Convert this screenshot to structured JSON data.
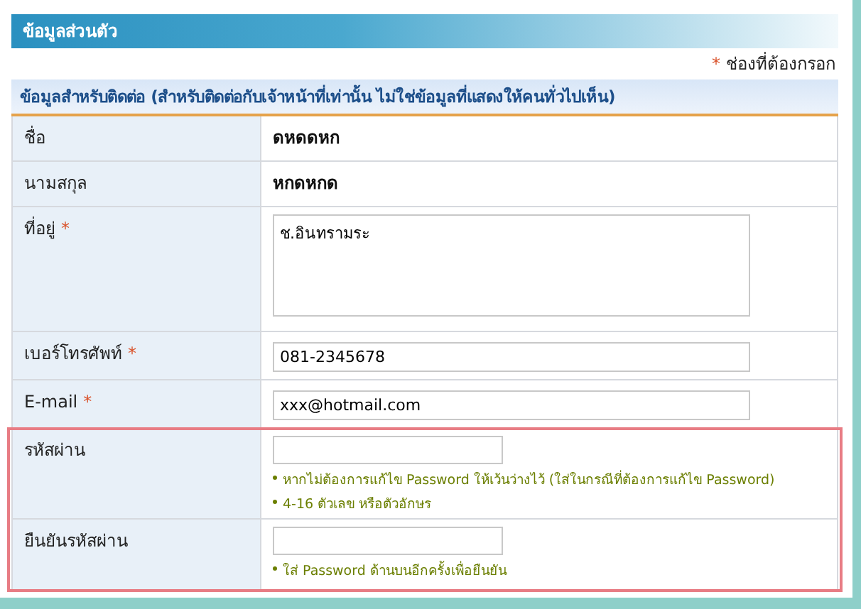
{
  "header": {
    "title": "ข้อมูลส่วนตัว"
  },
  "required_note": {
    "mark": "*",
    "text": "ช่องที่ต้องกรอก"
  },
  "section": {
    "title": "ข้อมูลสำหรับติดต่อ (สำหรับติดต่อกับเจ้าหน้าที่เท่านั้น ไม่ใช่ข้อมูลที่แสดงให้คนทั่วไปเห็น)"
  },
  "rows": [
    {
      "label": "ชื่อ",
      "required": false,
      "highlighted": false,
      "kind": "text",
      "value": "ดหดดหก"
    },
    {
      "label": "นามสกุล",
      "required": false,
      "highlighted": false,
      "kind": "text",
      "value": "หกดหกด"
    },
    {
      "label": "ที่อยู่",
      "required": true,
      "highlighted": false,
      "kind": "textarea",
      "value": "ช.อินทรามระ"
    },
    {
      "label": "เบอร์โทรศัพท์",
      "required": true,
      "highlighted": false,
      "kind": "input",
      "value": "081-2345678"
    },
    {
      "label": "E-mail",
      "required": true,
      "highlighted": false,
      "kind": "input",
      "value": "xxx@hotmail.com"
    },
    {
      "label": "รหัสผ่าน",
      "required": false,
      "highlighted": true,
      "kind": "password",
      "hints": [
        "หากไม่ต้องการแก้ไข Password ให้เว้นว่างไว้ (ใส่ในกรณีที่ต้องการแก้ไข Password)",
        "4-16 ตัวเลข หรือตัวอักษร"
      ]
    },
    {
      "label": "ยืนยันรหัสผ่าน",
      "required": false,
      "highlighted": true,
      "kind": "password",
      "hints": [
        "ใส่ Password ด้านบนอีกครั้งเพื่อยืนยัน"
      ]
    }
  ]
}
